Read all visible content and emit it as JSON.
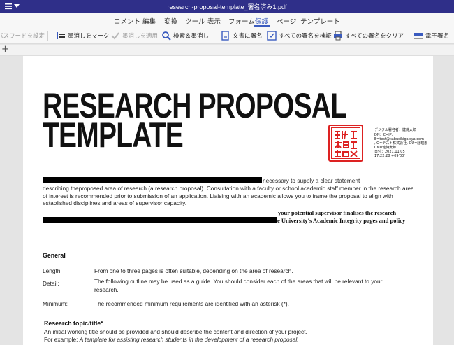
{
  "window": {
    "title": "research-proposal-template_署名済み1.pdf"
  },
  "menu": {
    "tabs": [
      {
        "label": "コメント"
      },
      {
        "label": "編集"
      },
      {
        "label": "変換"
      },
      {
        "label": "ツール"
      },
      {
        "label": "表示"
      },
      {
        "label": "フォーム"
      },
      {
        "label": "保護",
        "active": true
      },
      {
        "label": "ページ"
      },
      {
        "label": "テンプレート"
      }
    ]
  },
  "toolbar": {
    "password_label": "パスワードを設定",
    "mark_redaction_label": "墨消しをマーク",
    "apply_redaction_label": "墨消しを適用",
    "search_redact_label": "検索＆墨消し",
    "sign_document_label": "文書に署名",
    "verify_signatures_label": "すべての署名を検証",
    "clear_signatures_label": "すべての署名をクリア",
    "e_signature_label": "電子署名"
  },
  "document": {
    "title_line1": "RESEARCH PROPOSAL",
    "title_line2": "TEMPLATE",
    "signature_text": {
      "line1": "デジタル署名者：健侍太郎",
      "line2": "DN：C=JP,",
      "line3": "E=test@kabusikigaisya.com",
      "line4": ", O=テスト株式会社, OU=経理部",
      "line5": "CN=健侍太郎",
      "line6": "日付：2021.11.05",
      "line7": "17:22:28 +09'00'"
    },
    "intro_tail": "necessary to supply a clear statement",
    "intro_body": "describing theproposed area of research (a research proposal). Consultation with a faculty or school academic staff member in the research area of interest is recommended prior to submission of an application. Liaising with an academic allows you to frame the proposal to align with established disciplines and areas of supervisor capacity.",
    "serif_line1": "your potential supervisor finalises the research",
    "serif_line2": "e University's Academic Integrity pages and policy",
    "general_heading": "General",
    "rows": [
      {
        "label": "Length:",
        "text": "From one to three pages is often suitable, depending on the area of research."
      },
      {
        "label": "Detail:",
        "text": "The following outline may be used as a guide. You should consider each of the areas that will be relevant to your research."
      },
      {
        "label": "Minimum:",
        "text": "The recommended minimum requirements are identified with an asterisk (*)."
      }
    ],
    "topic_heading": "Research topic/title*",
    "topic_line1": "An initial working title should be provided and should describe the content and direction of your project.",
    "topic_line2_prefix": "For example: ",
    "topic_line2_italic": "A template for assisting research students in the development of a research proposal."
  },
  "colors": {
    "titlebar": "#2f2f89",
    "accent": "#3a5bbf",
    "stamp_red": "#d22222"
  }
}
